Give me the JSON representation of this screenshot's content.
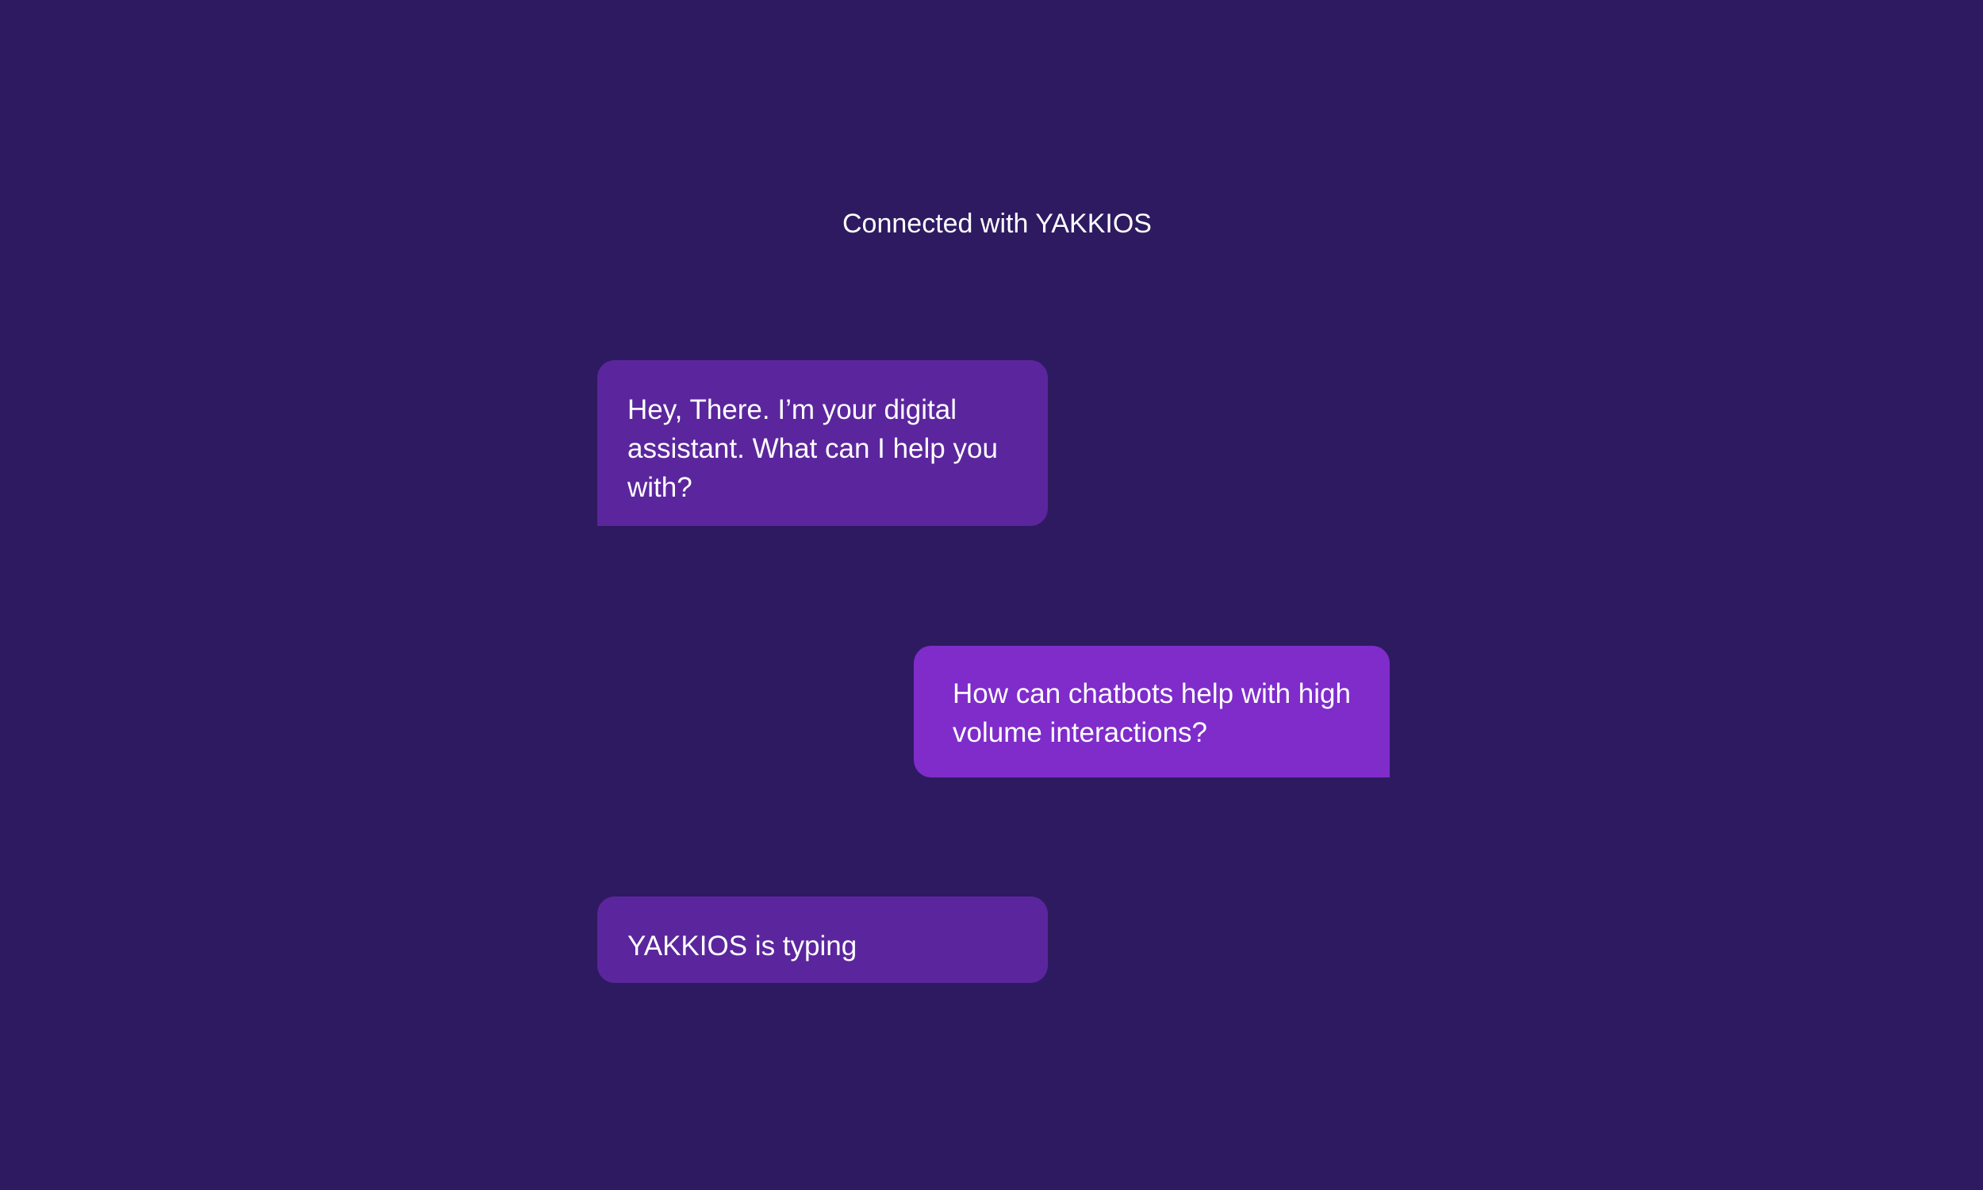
{
  "colors": {
    "background": "#2e1a61",
    "bot_bubble": "#5b269d",
    "user_bubble": "#7f2ccb",
    "text": "#ffffff"
  },
  "chat": {
    "connection_status": "Connected with YAKKIOS",
    "messages": [
      {
        "sender": "bot",
        "text": "Hey, There. I’m your digital assistant. What can I help you with?"
      },
      {
        "sender": "user",
        "text": "How can chatbots help with high volume interactions?"
      }
    ],
    "typing_indicator": "YAKKIOS is typing"
  }
}
